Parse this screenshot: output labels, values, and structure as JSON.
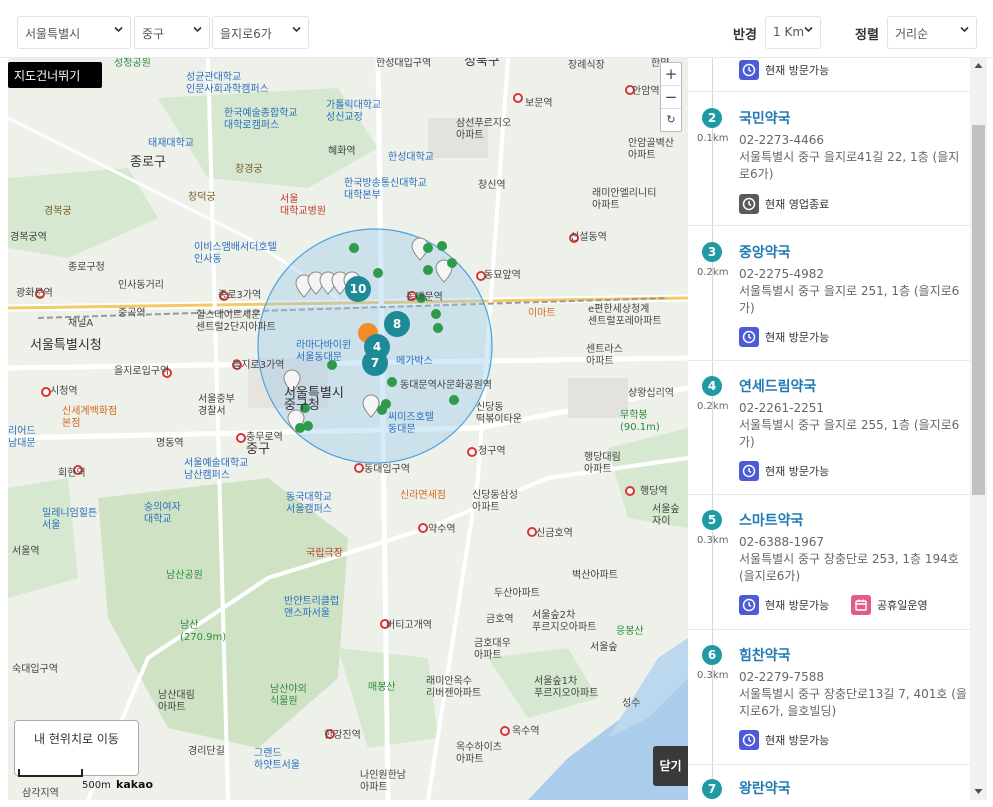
{
  "filters": {
    "city": "서울특별시",
    "district": "중구",
    "dong": "을지로6가",
    "radius_label": "반경",
    "radius_value": "1 Km",
    "sort_label": "정렬",
    "sort_value": "거리순"
  },
  "map": {
    "skip_label": "지도건너뛰기",
    "zoom_in": "+",
    "zoom_out": "−",
    "reset": "↻",
    "my_location_label": "내 현위치로 이동",
    "close_label": "닫기",
    "scale_label": "500m",
    "provider": "kakao",
    "markers": [
      "10",
      "8",
      "4",
      "7"
    ],
    "places": {
      "p1": "성균관대학교\n인문사회과학캠퍼스",
      "p2": "한국예술종합학교\n대학로캠퍼스",
      "p3": "가톨릭대학교\n성신교정",
      "p4": "태재대학교",
      "p5": "종로구",
      "p6": "창경궁",
      "p7": "혜화역",
      "p8": "한성대학교",
      "p9": "한국방송통신대학교\n대학본부",
      "p10": "삼선푸르지오\n아파트",
      "p11": "창신역",
      "p12": "보문역",
      "p13": "안암골벽산\n아파트",
      "p14": "래미안엘리니티\n아파트",
      "p15": "경복궁",
      "p16": "창덕궁",
      "p17": "서울\n대학교병원",
      "p18": "경복궁역",
      "p19": "종로구청",
      "p20": "이비스앰배서더호텔\n인사동",
      "p21": "신설동역",
      "p22": "동묘앞역",
      "p23": "광화문역",
      "p24": "인사동거리",
      "p25": "종로3가역",
      "p26": "동대문역",
      "p27": "채널A",
      "p28": "중곡역",
      "p29": "힐스테이트세운\n센트럴2단지아파트",
      "p30": "이마트",
      "p31": "e편한세상청계\n센트럴포레아파트",
      "p32": "서울특별시청",
      "p33": "라마다바이윈\n서울동대문",
      "p34": "을지로입구역",
      "p35": "을지로3가역",
      "p36": "메가박스",
      "p37": "센트라스\n아파트",
      "p38": "시청역",
      "p39": "서울특별시\n중구청",
      "p40": "동대문역사문화공원역",
      "p41": "상왕십리역",
      "p42": "신세계백화점\n본점",
      "p43": "서울중부\n경찰서",
      "p44": "신당동\n떡볶이타운",
      "p45": "무학봉\n(90.1m)",
      "p46": "명동역",
      "p47": "충무로역",
      "p48": "씨미즈호텔\n동대문",
      "p49": "청구역",
      "p50": "중구",
      "p51": "행당대림\n아파트",
      "p52": "회현역",
      "p53": "서울예술대학교\n남산캠퍼스",
      "p54": "동대입구역",
      "p55": "행당역",
      "p56": "숭의여자\n대학교",
      "p57": "동국대학교\n서울캠퍼스",
      "p58": "신라면세점",
      "p59": "신당동삼성\n아파트",
      "p60": "밀레니엄힐튼\n서울",
      "p61": "약수역",
      "p62": "신금호역",
      "p63": "서울역",
      "p64": "국립극장",
      "p65": "남산공원",
      "p66": "벽산아파트",
      "p67": "반얀트리클럽\n앤스파서울",
      "p68": "두산아파트",
      "p69": "남산\n(270.9m)",
      "p70": "버티고개역",
      "p71": "금호역",
      "p72": "서울숲2차\n푸르지오아파트",
      "p73": "응봉산",
      "p74": "금호대우\n아파트",
      "p75": "숙대입구역",
      "p76": "매봉산",
      "p77": "래미안옥수\n리버젠아파트",
      "p78": "서울숲1차\n푸르지오아파트",
      "p79": "남산대림\n아파트",
      "p80": "남산야외\n식물원",
      "p81": "한강진역",
      "p82": "옥수역",
      "p83": "경리단길",
      "p84": "그랜드\n하얏트서울",
      "p85": "옥수하이츠\n아파트",
      "p86": "나인원한남\n아파트",
      "p87": "성수",
      "p88": "한성대입구역",
      "p89": "성북구",
      "p90": "장례식장",
      "p91": "안암역",
      "p92": "성정공원",
      "p93": "서울숲\n자이",
      "p94": "삼각지역",
      "p95": "한양",
      "p96": "리어드\n남대문",
      "p97": "서울숲"
    }
  },
  "list": {
    "top_status": "현재 방문가능",
    "items": [
      {
        "num": "2",
        "dist": "0.1km",
        "name": "국민약국",
        "phone": "02-2273-4466",
        "addr": "서울특별시 중구 을지로41길 22, 1층 (을지로6가)",
        "status": "현재 영업종료"
      },
      {
        "num": "3",
        "dist": "0.2km",
        "name": "중앙약국",
        "phone": "02-2275-4982",
        "addr": "서울특별시 중구 을지로 251, 1층 (을지로6가)",
        "status": "현재 방문가능"
      },
      {
        "num": "4",
        "dist": "0.2km",
        "name": "연세드림약국",
        "phone": "02-2261-2251",
        "addr": "서울특별시 중구 을지로 255, 1층 (을지로6가)",
        "status": "현재 방문가능"
      },
      {
        "num": "5",
        "dist": "0.3km",
        "name": "스마트약국",
        "phone": "02-6388-1967",
        "addr": "서울특별시 중구 장충단로 253, 1층 194호 (을지로6가)",
        "status": "현재 방문가능",
        "extra": "공휴일운영"
      },
      {
        "num": "6",
        "dist": "0.3km",
        "name": "힘찬약국",
        "phone": "02-2279-7588",
        "addr": "서울특별시 중구 장충단로13길 7, 401호 (을지로6가, 을호빌딩)",
        "status": "현재 방문가능"
      },
      {
        "num": "7",
        "name": "왕란약국"
      }
    ]
  },
  "colors": {
    "accent": "#1f9aa5",
    "status_open": "#4d5bd6",
    "status_closed": "#5a5a5a",
    "holiday": "#e05c89",
    "name_link": "#1f7ab4"
  }
}
